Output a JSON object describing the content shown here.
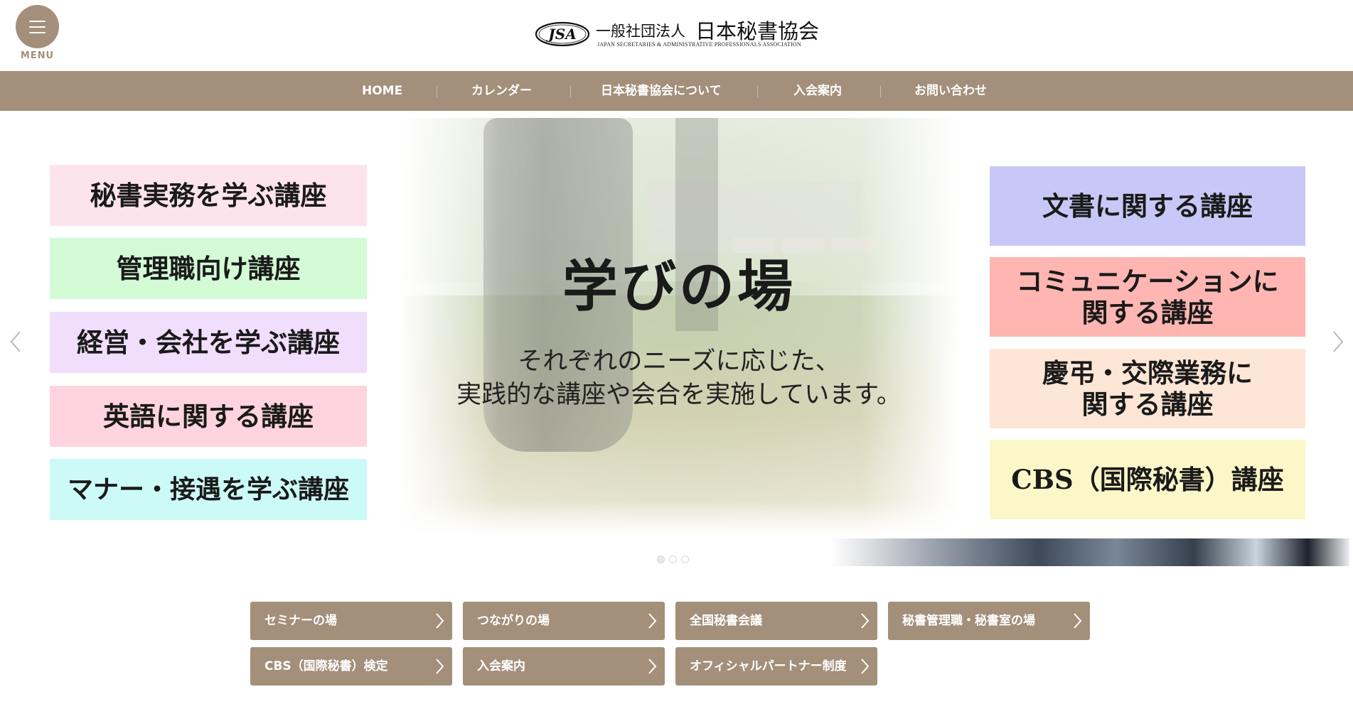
{
  "header": {
    "menu_label": "MENU",
    "logo_emblem_text": "JSA",
    "logo_prefix": "一般社団法人",
    "logo_name": "日本秘書協会",
    "logo_subtitle": "JAPAN SECRETARIES & ADMINISTRATIVE PROFESSIONALS ASSOCIATION"
  },
  "nav": {
    "items": [
      {
        "label": "HOME"
      },
      {
        "label": "カレンダー"
      },
      {
        "label": "日本秘書協会について"
      },
      {
        "label": "入会案内"
      },
      {
        "label": "お問い合わせ"
      }
    ]
  },
  "slider": {
    "title": "学びの場",
    "subtitle_line1": "それぞれのニーズに応じた、",
    "subtitle_line2": "実践的な講座や会合を実施しています。",
    "left_courses": [
      {
        "label": "秘書実務を学ぶ講座",
        "color": "#fde4ec"
      },
      {
        "label": "管理職向け講座",
        "color": "#d2fbd6"
      },
      {
        "label": "経営・会社を学ぶ講座",
        "color": "#f0defc"
      },
      {
        "label": "英語に関する講座",
        "color": "#ffd4de"
      },
      {
        "label": "マナー・接遇を学ぶ講座",
        "color": "#ccfaf6"
      }
    ],
    "right_courses": [
      {
        "line1": "文書に関する講座",
        "line2": "",
        "color": "#c8c8f8"
      },
      {
        "line1": "コミュニケーションに",
        "line2": "関する講座",
        "color": "#ffb6b2"
      },
      {
        "line1": "慶弔・交際業務に",
        "line2": "関する講座",
        "color": "#fde6d6"
      },
      {
        "line1": "CBS（国際秘書）講座",
        "line2": "",
        "color": "#fcf7c8"
      }
    ],
    "slide_count": 3,
    "active_slide": 1
  },
  "buttons": [
    {
      "label": "セミナーの場"
    },
    {
      "label": "つながりの場"
    },
    {
      "label": "全国秘書会議"
    },
    {
      "label": "秘書管理職・秘書室の場"
    },
    {
      "label": "CBS（国際秘書）検定"
    },
    {
      "label": "入会案内"
    },
    {
      "label": "オフィシャルパートナー制度"
    }
  ],
  "colors": {
    "brand": "#a38f7a",
    "text": "#1a1a1a"
  }
}
